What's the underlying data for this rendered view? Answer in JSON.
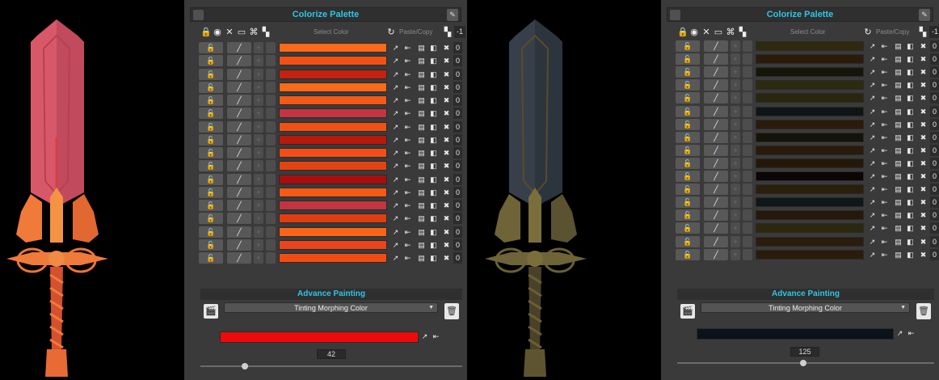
{
  "left_panel": {
    "title": "Colorize Palette",
    "select_color_label": "Select Color",
    "paste_copy_label": "Paste/Copy",
    "neg_one": "-1",
    "rows": [
      {
        "color": "#fa6a18",
        "num": "0"
      },
      {
        "color": "#f35113",
        "num": "0"
      },
      {
        "color": "#c4220f",
        "num": "0"
      },
      {
        "color": "#fb6a18",
        "num": "0"
      },
      {
        "color": "#f35a18",
        "num": "0"
      },
      {
        "color": "#c33440",
        "num": "0"
      },
      {
        "color": "#f24f14",
        "num": "0"
      },
      {
        "color": "#b7190c",
        "num": "0"
      },
      {
        "color": "#f54d15",
        "num": "0"
      },
      {
        "color": "#e54212",
        "num": "0"
      },
      {
        "color": "#a80e0f",
        "num": "0"
      },
      {
        "color": "#f55a16",
        "num": "0"
      },
      {
        "color": "#c43340",
        "num": "0"
      },
      {
        "color": "#e03d12",
        "num": "0"
      },
      {
        "color": "#fa6418",
        "num": "0"
      },
      {
        "color": "#e9441c",
        "num": "0"
      },
      {
        "color": "#f24c15",
        "num": "0"
      }
    ],
    "advance_title": "Advance Painting",
    "mode_label": "Tinting Morphing Color",
    "morph_color": "#ee0a0a",
    "value": "42",
    "slider_fraction": 0.17
  },
  "right_panel": {
    "title": "Colorize Palette",
    "select_color_label": "Select Color",
    "paste_copy_label": "Paste/Copy",
    "neg_one": "-1",
    "rows": [
      {
        "color": "#2d2a10",
        "num": "0"
      },
      {
        "color": "#2b1b0b",
        "num": "0"
      },
      {
        "color": "#161509",
        "num": "0"
      },
      {
        "color": "#2c2a10",
        "num": "0"
      },
      {
        "color": "#2a260e",
        "num": "0"
      },
      {
        "color": "#0f1516",
        "num": "0"
      },
      {
        "color": "#2a1b0b",
        "num": "0"
      },
      {
        "color": "#141309",
        "num": "0"
      },
      {
        "color": "#2a1a0b",
        "num": "0"
      },
      {
        "color": "#241809",
        "num": "0"
      },
      {
        "color": "#0c0505",
        "num": "0"
      },
      {
        "color": "#2a1f0b",
        "num": "0"
      },
      {
        "color": "#0f1718",
        "num": "0"
      },
      {
        "color": "#26180a",
        "num": "0"
      },
      {
        "color": "#2c2810",
        "num": "0"
      },
      {
        "color": "#2a1d0c",
        "num": "0"
      },
      {
        "color": "#2a1c0b",
        "num": "0"
      }
    ],
    "advance_title": "Advance Painting",
    "mode_label": "Tinting Morphing Color",
    "morph_color": "#0a121c",
    "value": "125",
    "slider_fraction": 0.49
  },
  "colors": {
    "accent": "#2ec5e6",
    "panel_bg": "#3a3a3a",
    "sword_red_blade": "#d8586a",
    "sword_red_guard": "#f07a3a",
    "sword_dark_blade": "#37404a",
    "sword_dark_guard": "#6e6438"
  },
  "icons": {
    "lock": "lock-icon",
    "eye": "eye-icon",
    "close": "close-icon",
    "frame": "frame-icon",
    "pin": "pin-icon",
    "eyedropper": "eyedropper-icon",
    "apply": "apply-arrow-icon",
    "paste": "paste-icon",
    "copy": "copy-icon",
    "reset": "reset-icon",
    "brush": "brush-icon",
    "film": "film-icon",
    "trash": "trash-icon"
  }
}
